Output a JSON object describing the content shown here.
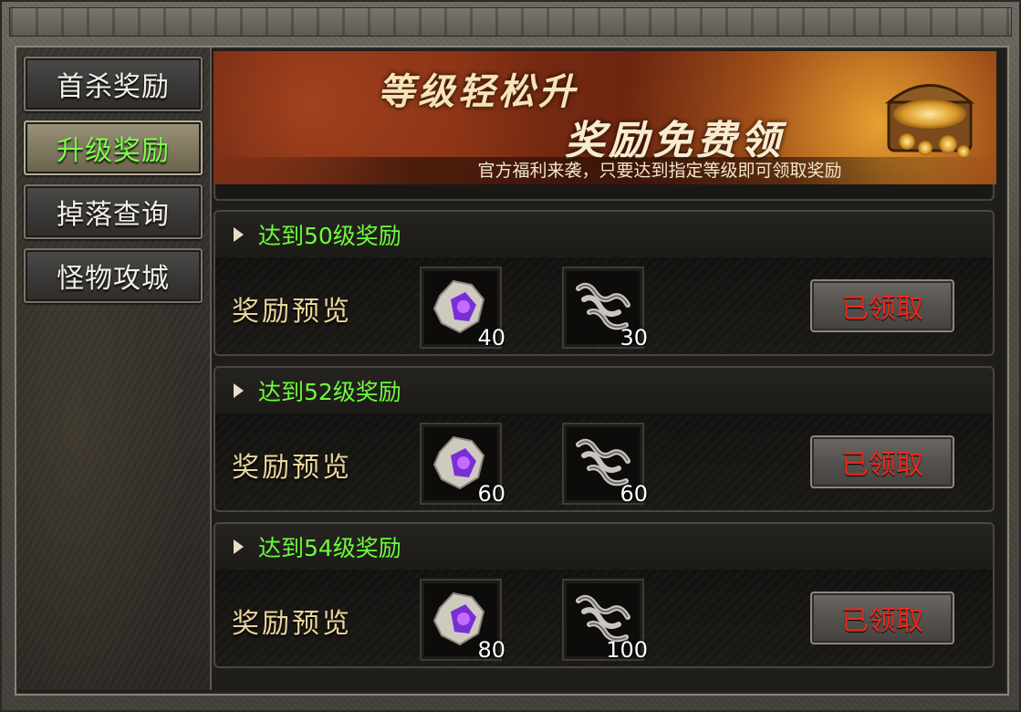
{
  "sidebar": {
    "tabs": [
      {
        "label": "首杀奖励"
      },
      {
        "label": "升级奖励"
      },
      {
        "label": "掉落查询"
      },
      {
        "label": "怪物攻城"
      }
    ]
  },
  "banner": {
    "headline_1": "等级轻松升",
    "headline_2": "奖励免费领",
    "subtitle": "官方福利来袭，只要达到指定等级即可领取奖励"
  },
  "rewards": [
    {
      "title": "达到50级奖励",
      "preview_label": "奖励预览",
      "items": [
        {
          "icon": "purple-crystal-icon",
          "qty": "40"
        },
        {
          "icon": "scroll-icon",
          "qty": "30"
        }
      ],
      "button_label": "已领取"
    },
    {
      "title": "达到52级奖励",
      "preview_label": "奖励预览",
      "items": [
        {
          "icon": "purple-crystal-icon",
          "qty": "60"
        },
        {
          "icon": "scroll-icon",
          "qty": "60"
        }
      ],
      "button_label": "已领取"
    },
    {
      "title": "达到54级奖励",
      "preview_label": "奖励预览",
      "items": [
        {
          "icon": "purple-crystal-icon",
          "qty": "80"
        },
        {
          "icon": "scroll-icon",
          "qty": "100"
        }
      ],
      "button_label": "已领取"
    }
  ],
  "colors": {
    "active_tab_text": "#7cff4a",
    "title_green": "#6dfc3c",
    "claimed_red": "#e82a1e"
  }
}
